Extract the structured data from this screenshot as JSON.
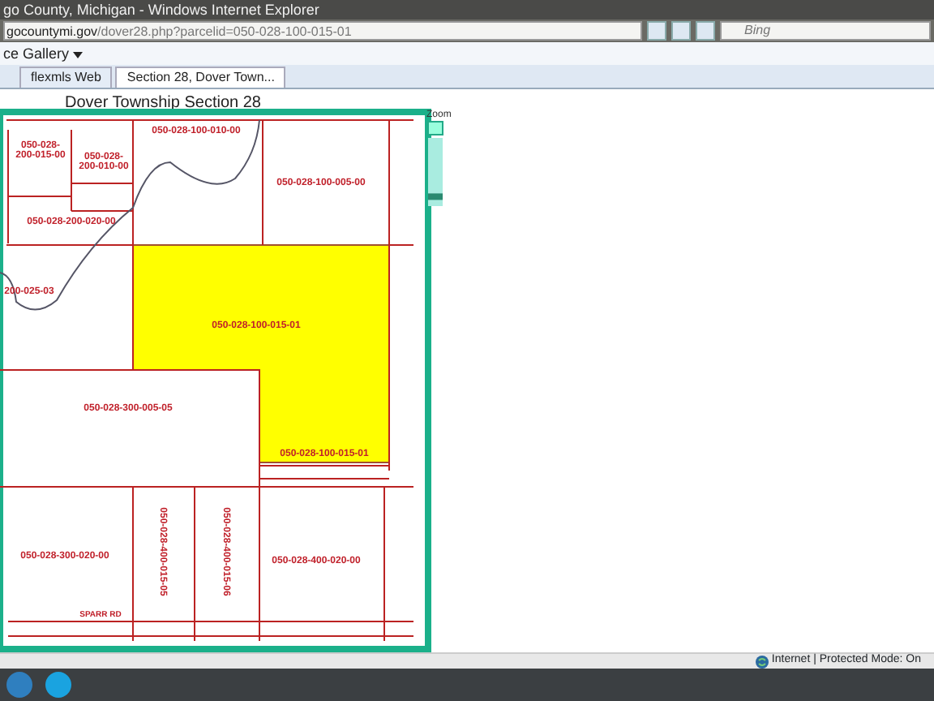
{
  "window": {
    "title": "go County, Michigan - Windows Internet Explorer"
  },
  "address_bar": {
    "domain": "gocountymi.gov",
    "path": "/dover28.php?parcelid=050-028-100-015-01"
  },
  "search": {
    "placeholder": "Bing"
  },
  "command_bar": {
    "label": "ce Gallery"
  },
  "tabs": [
    {
      "label": "flexmls Web",
      "selected": false
    },
    {
      "label": "Section 28, Dover Town...",
      "selected": true
    }
  ],
  "map": {
    "title": "Dover Township Section 28",
    "zoom": {
      "label": "Zoom",
      "level": 0.1
    },
    "labels": [
      {
        "kind": "parcel",
        "text": "050-028-100-010-00"
      },
      {
        "kind": "parcel",
        "text": "050-028-"
      },
      {
        "kind": "parcel",
        "text": "200-015-00"
      },
      {
        "kind": "parcel",
        "text": "050-028-"
      },
      {
        "kind": "parcel",
        "text": "200-010-00"
      },
      {
        "kind": "parcel",
        "text": "050-028-100-005-00"
      },
      {
        "kind": "parcel",
        "text": "050-028-200-020-00"
      },
      {
        "kind": "parcel",
        "text": "200-025-03"
      },
      {
        "kind": "parcel",
        "text": "050-028-100-015-01"
      },
      {
        "kind": "parcel",
        "text": "050-028-300-005-05"
      },
      {
        "kind": "parcel",
        "text": "050-028-100-015-01"
      },
      {
        "kind": "parcel",
        "text": "050-028-300-020-00"
      },
      {
        "kind": "vertical",
        "text": "050-028-400-015-05"
      },
      {
        "kind": "vertical",
        "text": "050-028-400-015-06"
      },
      {
        "kind": "parcel",
        "text": "050-028-400-020-00"
      },
      {
        "kind": "road",
        "text": "SPARR RD"
      }
    ]
  },
  "status_bar": {
    "zone": "Internet | Protected Mode: On"
  }
}
